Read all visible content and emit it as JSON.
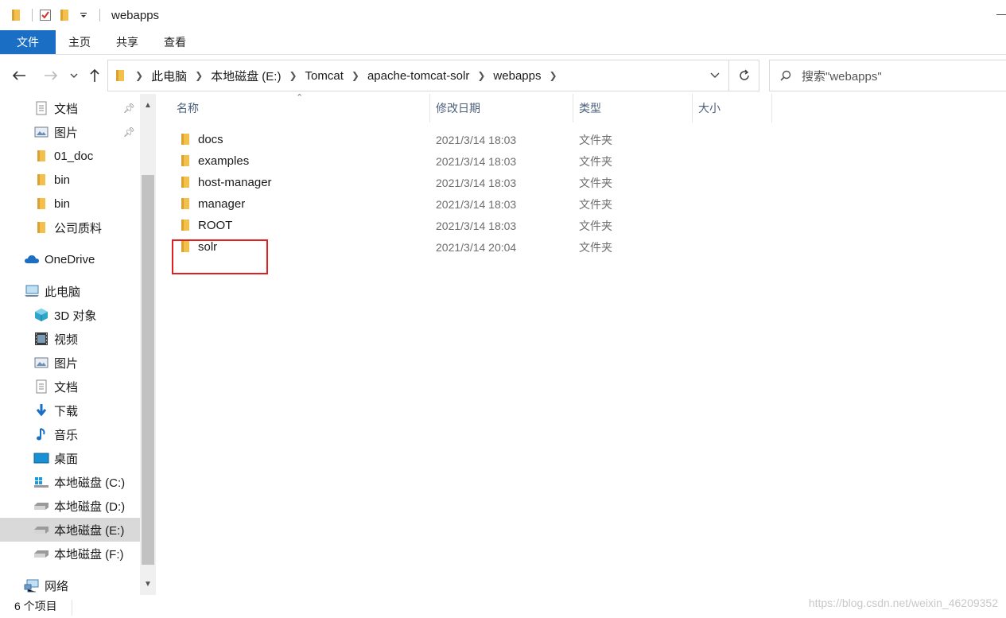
{
  "window": {
    "title": "webapps"
  },
  "ribbon": {
    "tabs": [
      "文件",
      "主页",
      "共享",
      "查看"
    ]
  },
  "address": {
    "crumbs": [
      "此电脑",
      "本地磁盘 (E:)",
      "Tomcat",
      "apache-tomcat-solr",
      "webapps"
    ]
  },
  "search": {
    "placeholder": "搜索\"webapps\""
  },
  "sidebar": {
    "items": [
      {
        "label": "文档",
        "icon": "document-icon",
        "pinned": true
      },
      {
        "label": "图片",
        "icon": "picture-icon",
        "pinned": true
      },
      {
        "label": "01_doc",
        "icon": "folder-icon"
      },
      {
        "label": "bin",
        "icon": "folder-icon"
      },
      {
        "label": "bin",
        "icon": "folder-icon"
      },
      {
        "label": "公司质料",
        "icon": "folder-icon"
      },
      {
        "label": "OneDrive",
        "icon": "onedrive-icon"
      },
      {
        "label": "此电脑",
        "icon": "this-pc-icon"
      },
      {
        "label": "3D 对象",
        "icon": "3d-objects-icon"
      },
      {
        "label": "视频",
        "icon": "video-icon"
      },
      {
        "label": "图片",
        "icon": "picture-icon"
      },
      {
        "label": "文档",
        "icon": "document-icon"
      },
      {
        "label": "下载",
        "icon": "download-icon"
      },
      {
        "label": "音乐",
        "icon": "music-icon"
      },
      {
        "label": "桌面",
        "icon": "desktop-icon"
      },
      {
        "label": "本地磁盘 (C:)",
        "icon": "windows-drive-icon"
      },
      {
        "label": "本地磁盘 (D:)",
        "icon": "drive-icon"
      },
      {
        "label": "本地磁盘 (E:)",
        "icon": "drive-icon",
        "selected": true
      },
      {
        "label": "本地磁盘 (F:)",
        "icon": "drive-icon"
      },
      {
        "label": "网络",
        "icon": "network-icon"
      }
    ]
  },
  "columns": {
    "name": "名称",
    "modified": "修改日期",
    "type": "类型",
    "size": "大小"
  },
  "files": [
    {
      "name": "docs",
      "modified": "2021/3/14 18:03",
      "type": "文件夹"
    },
    {
      "name": "examples",
      "modified": "2021/3/14 18:03",
      "type": "文件夹"
    },
    {
      "name": "host-manager",
      "modified": "2021/3/14 18:03",
      "type": "文件夹"
    },
    {
      "name": "manager",
      "modified": "2021/3/14 18:03",
      "type": "文件夹"
    },
    {
      "name": "ROOT",
      "modified": "2021/3/14 18:03",
      "type": "文件夹"
    },
    {
      "name": "solr",
      "modified": "2021/3/14 20:04",
      "type": "文件夹"
    }
  ],
  "status": {
    "item_count": "6 个项目"
  },
  "watermark": "https://blog.csdn.net/weixin_46209352",
  "colors": {
    "accent": "#1a6fc4",
    "folder": "#f3c14b",
    "highlight": "#e02020"
  }
}
